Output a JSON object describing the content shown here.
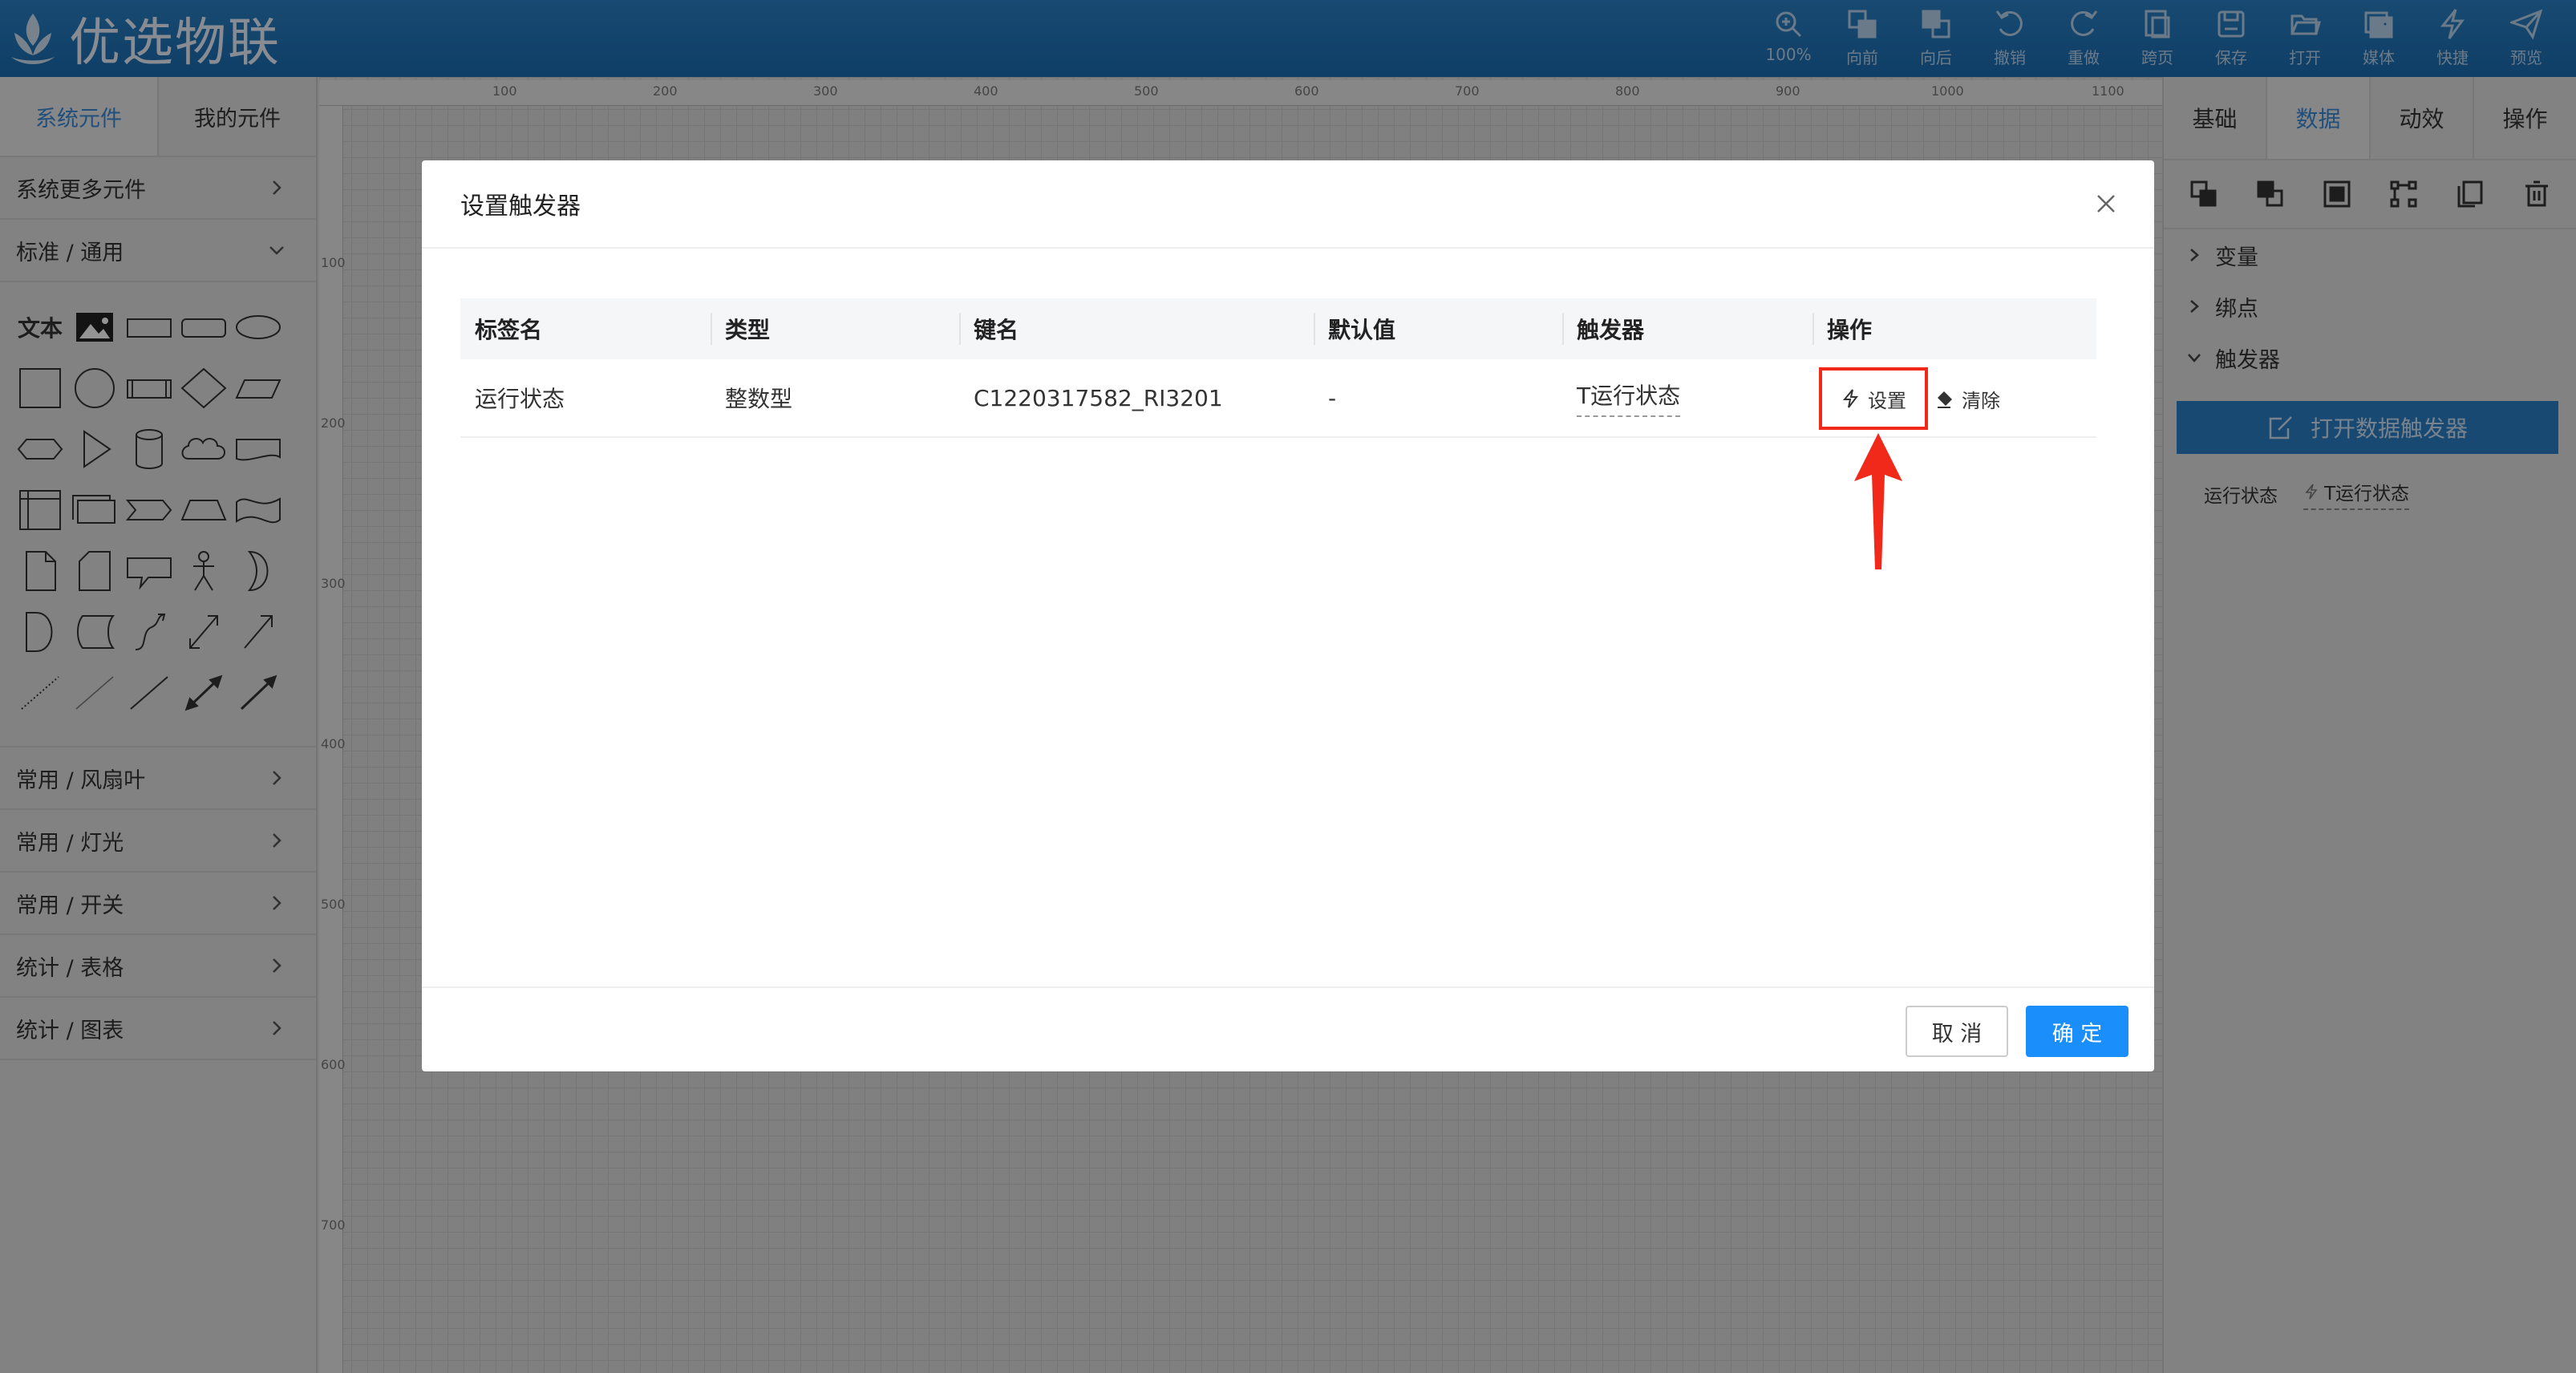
{
  "app": {
    "logo_text": "优选物联"
  },
  "toolbar": {
    "items": [
      {
        "label": "100%",
        "icon": "zoom-in-icon"
      },
      {
        "label": "向前",
        "icon": "bring-forward-icon"
      },
      {
        "label": "向后",
        "icon": "send-backward-icon"
      },
      {
        "label": "撤销",
        "icon": "undo-icon"
      },
      {
        "label": "重做",
        "icon": "redo-icon"
      },
      {
        "label": "跨页",
        "icon": "cross-page-icon"
      },
      {
        "label": "保存",
        "icon": "save-icon"
      },
      {
        "label": "打开",
        "icon": "folder-open-icon"
      },
      {
        "label": "媒体",
        "icon": "media-icon"
      },
      {
        "label": "快捷",
        "icon": "lightning-icon"
      },
      {
        "label": "预览",
        "icon": "paper-plane-icon"
      }
    ]
  },
  "left_panel": {
    "tabs": [
      "系统元件",
      "我的元件"
    ],
    "sections": {
      "more": "系统更多元件",
      "standard": "标准 / 通用",
      "fan": "常用 / 风扇叶",
      "light": "常用 / 灯光",
      "switch": "常用 / 开关",
      "table": "统计 / 表格",
      "chart": "统计 / 图表"
    },
    "text_tool": "文本"
  },
  "ruler": {
    "top": [
      "100",
      "200",
      "300",
      "400",
      "500",
      "600",
      "700",
      "800",
      "900",
      "1000",
      "1100"
    ],
    "left": [
      "100",
      "200",
      "300",
      "400",
      "500",
      "600",
      "700"
    ]
  },
  "right_panel": {
    "tabs": [
      "基础",
      "数据",
      "动效",
      "操作"
    ],
    "active_tab": "数据",
    "sections": {
      "variables": "变量",
      "binding": "绑点",
      "trigger": "触发器"
    },
    "open_trigger_button": "打开数据触发器",
    "variable_name": "运行状态",
    "variable_trigger": "T运行状态"
  },
  "modal": {
    "title": "设置触发器",
    "columns": [
      "标签名",
      "类型",
      "键名",
      "默认值",
      "触发器",
      "操作"
    ],
    "rows": [
      {
        "tag": "运行状态",
        "type": "整数型",
        "key": "C1220317582_RI3201",
        "default": "-",
        "trigger": "T运行状态",
        "set_label": "设置",
        "clear_label": "清除"
      }
    ],
    "cancel_label": "取 消",
    "ok_label": "确 定"
  },
  "colors": {
    "primary": "#1a8ffc",
    "header": "#1f74b8",
    "highlight": "#f0291a"
  }
}
